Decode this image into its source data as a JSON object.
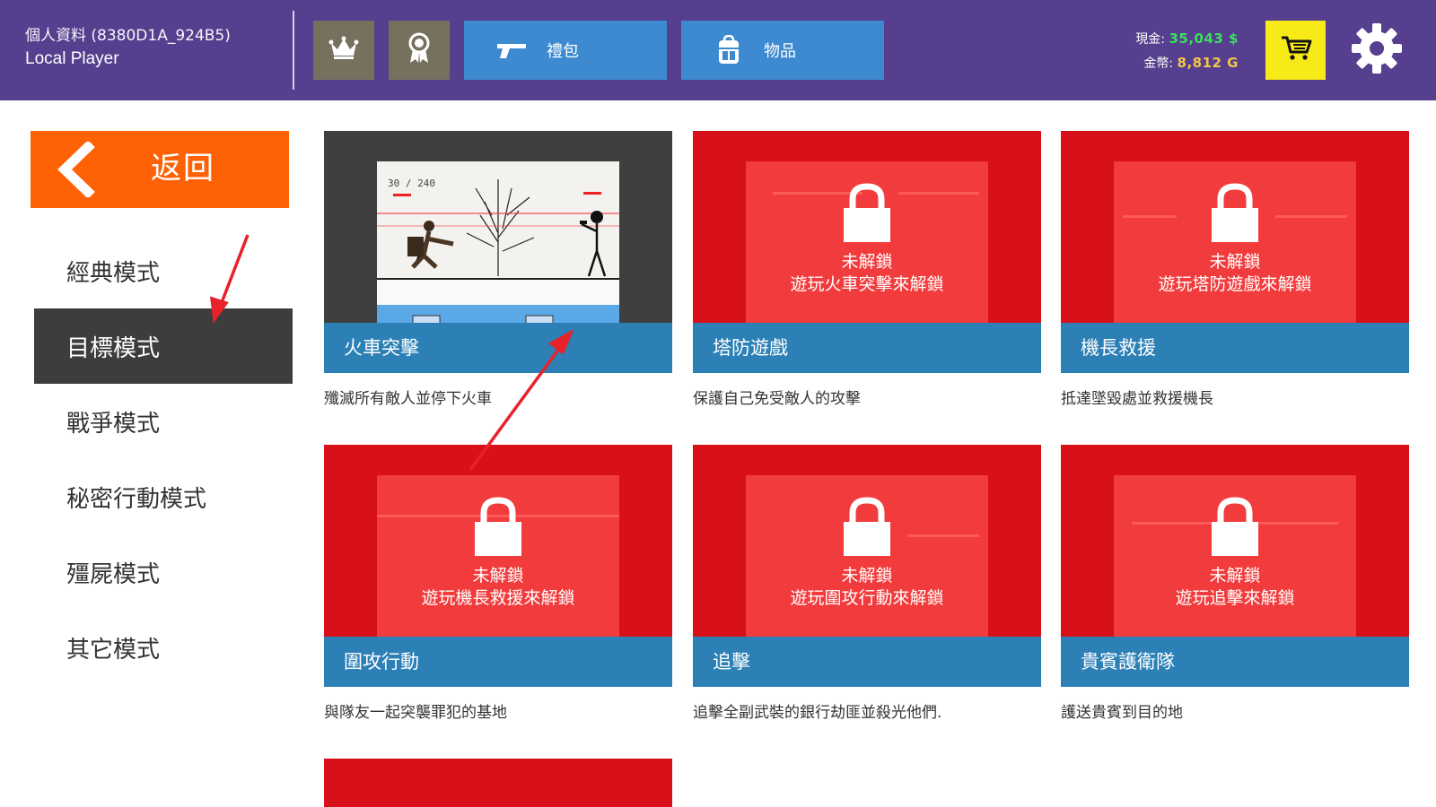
{
  "header": {
    "profile_label": "個人資料 (8380D1A_924B5)",
    "player_name": "Local Player",
    "gift_label": "禮包",
    "items_label": "物品",
    "cash_label": "現金:",
    "cash_value": "35,043 $",
    "gold_label": "金幣:",
    "gold_value": "8,812 G",
    "icons": [
      "crown-icon",
      "medal-icon",
      "pistol-icon",
      "backpack-icon",
      "cart-icon",
      "gear-icon"
    ]
  },
  "sidebar": {
    "back_label": "返回",
    "modes": [
      {
        "label": "經典模式",
        "active": false
      },
      {
        "label": "目標模式",
        "active": true
      },
      {
        "label": "戰爭模式",
        "active": false
      },
      {
        "label": "秘密行動模式",
        "active": false
      },
      {
        "label": "殭屍模式",
        "active": false
      },
      {
        "label": "其它模式",
        "active": false
      }
    ]
  },
  "cards": [
    {
      "title": "火車突擊",
      "desc": "殲滅所有敵人並停下火車",
      "locked": false,
      "hud": "30 / 240"
    },
    {
      "title": "塔防遊戲",
      "desc": "保護自己免受敵人的攻擊",
      "locked": true,
      "lock_line1": "未解鎖",
      "lock_line2": "遊玩火車突擊來解鎖"
    },
    {
      "title": "機長救援",
      "desc": "抵達墜毀處並救援機長",
      "locked": true,
      "lock_line1": "未解鎖",
      "lock_line2": "遊玩塔防遊戲來解鎖"
    },
    {
      "title": "圍攻行動",
      "desc": "與隊友一起突襲罪犯的基地",
      "locked": true,
      "lock_line1": "未解鎖",
      "lock_line2": "遊玩機長救援來解鎖"
    },
    {
      "title": "追擊",
      "desc": "追擊全副武裝的銀行劫匪並殺光他們.",
      "locked": true,
      "lock_line1": "未解鎖",
      "lock_line2": "遊玩圍攻行動來解鎖"
    },
    {
      "title": "貴賓護衛隊",
      "desc": "護送貴賓到目的地",
      "locked": true,
      "lock_line1": "未解鎖",
      "lock_line2": "遊玩追擊來解鎖"
    }
  ],
  "colors": {
    "topbar": "#553f8e",
    "back_button": "#ff6204",
    "active_mode": "#3d3d3d",
    "locked_card": "#d81019",
    "title_band": "#2c80b6",
    "cart": "#f8ea16",
    "cash": "#39e05c",
    "gold": "#f2c64a",
    "annotation_arrow": "#e8222a"
  }
}
